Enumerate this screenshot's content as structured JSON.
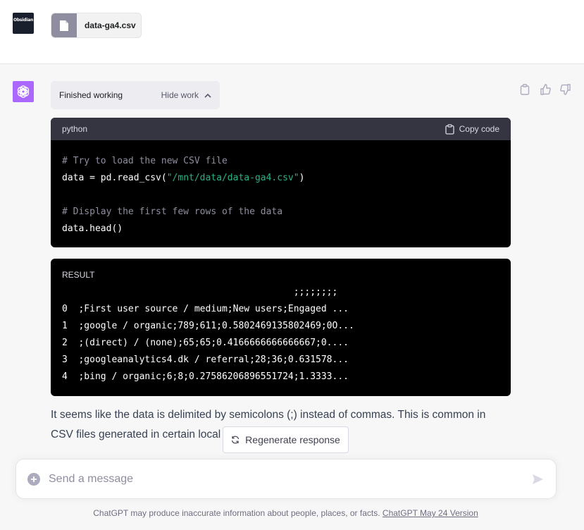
{
  "user_message": {
    "avatar_text": "Obsidian",
    "file_name": "data-ga4.csv",
    "file_icon": "document-icon"
  },
  "assistant": {
    "avatar_icon": "openai-logo-icon",
    "avatar_color": "#ab68ff",
    "work": {
      "status": "Finished working",
      "toggle_label": "Hide work"
    },
    "code": {
      "language": "python",
      "copy_label": "Copy code",
      "lines": [
        {
          "parts": [
            {
              "t": "cmt",
              "v": "# Try to load the new CSV file"
            }
          ]
        },
        {
          "parts": [
            {
              "t": "",
              "v": "data = pd.read_csv("
            },
            {
              "t": "str",
              "v": "\"/mnt/data/data-ga4.csv\""
            },
            {
              "t": "",
              "v": ")"
            }
          ]
        },
        {
          "parts": [
            {
              "t": "",
              "v": ""
            }
          ]
        },
        {
          "parts": [
            {
              "t": "cmt",
              "v": "# Display the first few rows of the data"
            }
          ]
        },
        {
          "parts": [
            {
              "t": "",
              "v": "data.head()"
            }
          ]
        }
      ]
    },
    "result": {
      "label": "RESULT",
      "lines": [
        "                                          ;;;;;;;;",
        "0  ;First user source / medium;New users;Engaged ...",
        "1  ;google / organic;789;611;0.5802469135802469;0O...",
        "2  ;(direct) / (none);65;65;0.4166666666666667;0....",
        "3  ;googleanalytics4.dk / referral;28;36;0.631578...",
        "4  ;bing / organic;6;8;0.27586206896551724;1.3333..."
      ]
    },
    "message": "It seems like the data is delimited by semicolons (;) instead of commas. This is common in CSV files generated in certain local"
  },
  "regenerate_label": "Regenerate response",
  "input": {
    "placeholder": "Send a message"
  },
  "disclaimer": {
    "text": "ChatGPT may produce inaccurate information about people, places, or facts. ",
    "link": "ChatGPT May 24 Version"
  },
  "colors": {
    "accent": "#ab68ff",
    "code_bg": "#000000",
    "code_header_bg": "#343541",
    "string": "#2ab384"
  }
}
